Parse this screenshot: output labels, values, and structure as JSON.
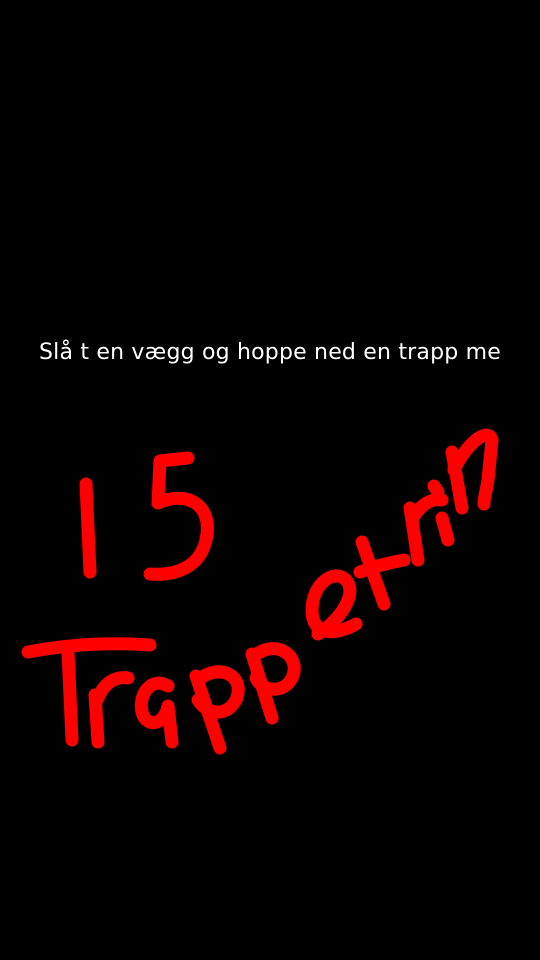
{
  "story": {
    "caption": "Slå t en vægg og hoppe ned en trapp me",
    "handwriting": {
      "line1": "15",
      "line2": "Trappetrin",
      "ink_color": "#ff0000"
    },
    "background_color": "#000000",
    "text_color": "#ffffff"
  }
}
